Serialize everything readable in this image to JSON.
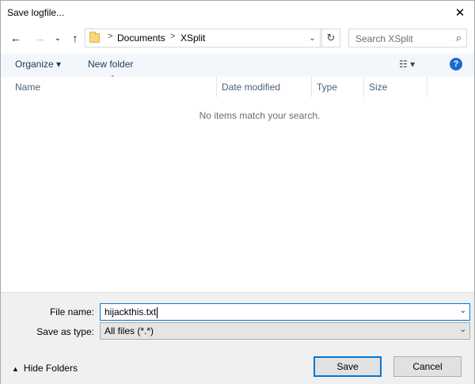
{
  "window": {
    "title": "Save logfile..."
  },
  "nav": {
    "back_icon": "←",
    "forward_icon": "→",
    "recent_icon": "⌄",
    "up_icon": "↑",
    "breadcrumbs": [
      "Documents",
      "XSplit"
    ],
    "breadcrumb_sep": ">",
    "search_placeholder": "Search XSplit"
  },
  "toolbar": {
    "organize": "Organize ▾",
    "new_folder": "New folder",
    "help": "?"
  },
  "list": {
    "columns": [
      "Name",
      "Date modified",
      "Type",
      "Size"
    ],
    "empty_message": "No items match your search."
  },
  "form": {
    "file_name_label": "File name:",
    "file_name_value": "hijackthis.txt",
    "save_type_label": "Save as type:",
    "save_type_value": "All files (*.*)"
  },
  "footer": {
    "hide_folders": "Hide Folders",
    "save": "Save",
    "cancel": "Cancel"
  }
}
